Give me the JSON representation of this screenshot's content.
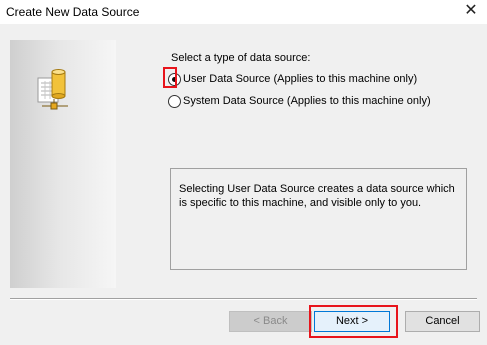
{
  "dialog": {
    "title": "Create New Data Source",
    "close_glyph": "✕",
    "side_icon": "database-network-icon"
  },
  "main": {
    "prompt": "Select a type of data source:",
    "options": [
      {
        "label": "User Data Source (Applies to this machine only)",
        "selected": true
      },
      {
        "label": "System Data Source (Applies to this machine only)",
        "selected": false
      }
    ],
    "description": "Selecting User Data Source creates a data source which is specific to this machine, and visible only to you."
  },
  "buttons": {
    "back": "< Back",
    "next": "Next >",
    "cancel": "Cancel"
  },
  "colors": {
    "highlight": "#e8141b",
    "focus": "#0078d7"
  }
}
